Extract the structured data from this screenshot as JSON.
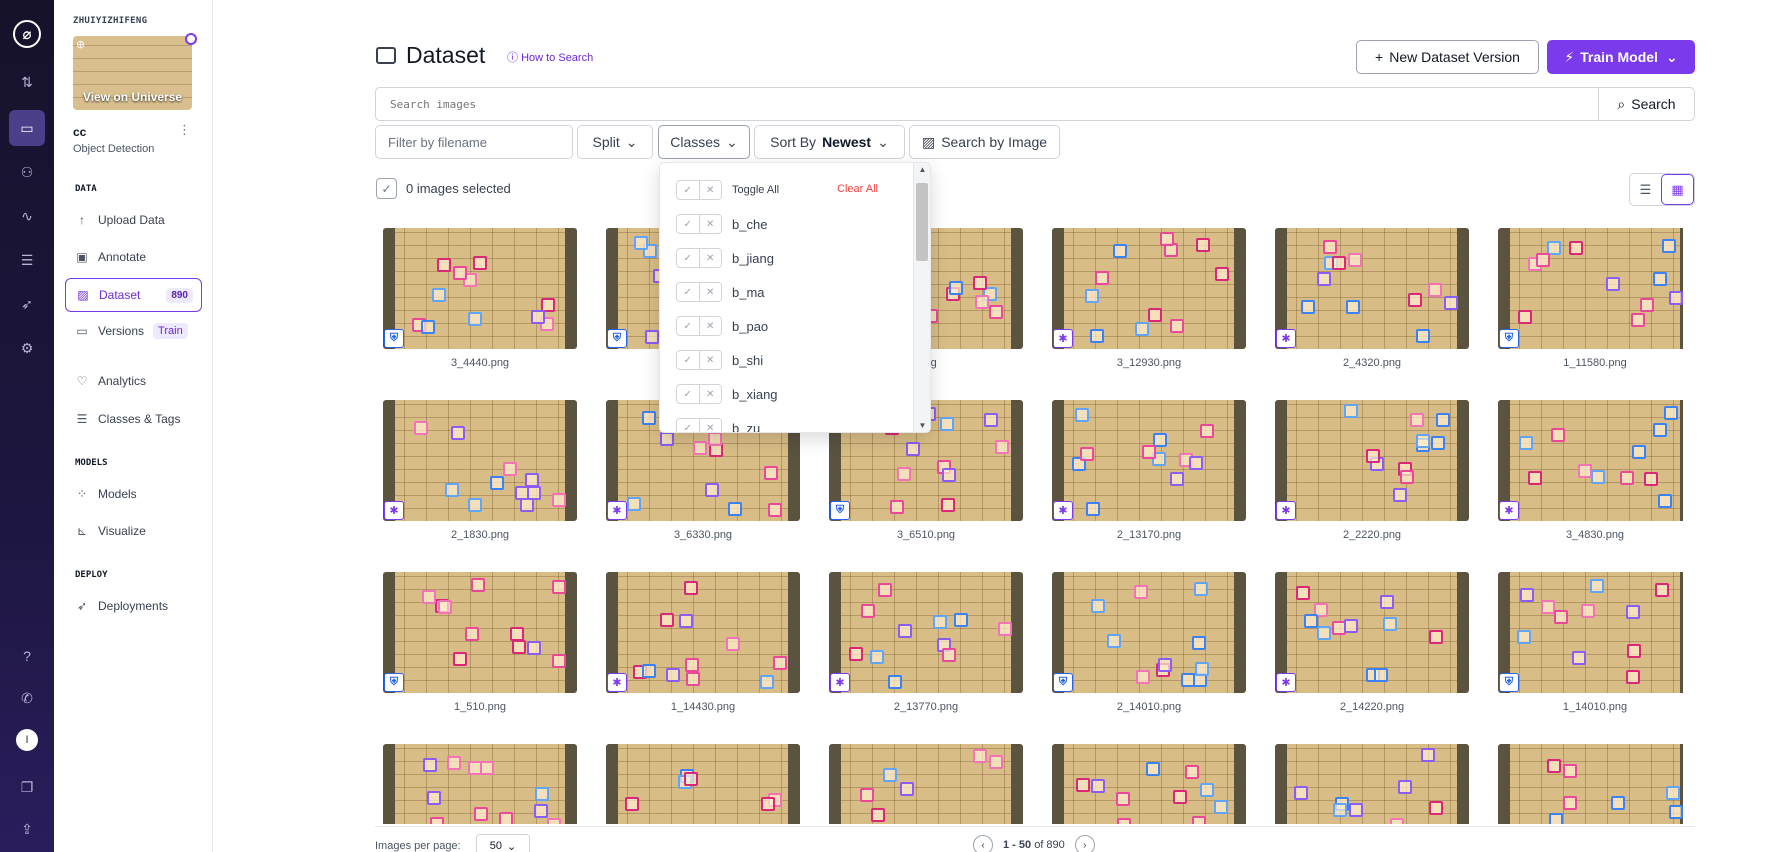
{
  "workspace": {
    "name": "ZHUIYIZHIFENG",
    "view_on_universe": "View on Universe"
  },
  "project": {
    "name": "cc",
    "type": "Object Detection"
  },
  "sidebar": {
    "sections": {
      "data": "DATA",
      "models": "MODELS",
      "deploy": "DEPLOY"
    },
    "items": [
      {
        "label": "Upload Data",
        "icon": "upload-icon"
      },
      {
        "label": "Annotate",
        "icon": "annotate-icon"
      },
      {
        "label": "Dataset",
        "icon": "dataset-icon",
        "badge": "890",
        "active": true
      },
      {
        "label": "Versions",
        "icon": "versions-icon",
        "badge": "Train"
      },
      {
        "label": "Analytics",
        "icon": "analytics-icon"
      },
      {
        "label": "Classes & Tags",
        "icon": "list-icon"
      },
      {
        "label": "Models",
        "icon": "models-icon"
      },
      {
        "label": "Visualize",
        "icon": "chart-icon"
      },
      {
        "label": "Deployments",
        "icon": "rocket-icon"
      }
    ],
    "avatar_letter": "I"
  },
  "header": {
    "title": "Dataset",
    "how_to_search": "How to Search",
    "new_version": "New Dataset Version",
    "train_model": "Train Model"
  },
  "search": {
    "placeholder": "Search images",
    "button": "Search"
  },
  "filters": {
    "filename_placeholder": "Filter by filename",
    "split": "Split",
    "classes": "Classes",
    "sort_label": "Sort By",
    "sort_value": "Newest",
    "search_by_image": "Search by Image"
  },
  "selection": {
    "text": "0 images selected"
  },
  "classes_dropdown": {
    "toggle_all": "Toggle All",
    "clear_all": "Clear All",
    "classes": [
      "b_che",
      "b_jiang",
      "b_ma",
      "b_pao",
      "b_shi",
      "b_xiang",
      "b_zu"
    ]
  },
  "images": [
    {
      "name": "3_4440.png",
      "badge": "shield"
    },
    {
      "name": "",
      "badge": "shield"
    },
    {
      "name": ".png",
      "badge": "shield"
    },
    {
      "name": "3_12930.png",
      "badge": "runner"
    },
    {
      "name": "2_4320.png",
      "badge": "runner"
    },
    {
      "name": "1_11580.png",
      "badge": "shield"
    },
    {
      "name": "2_1830.png",
      "badge": "runner"
    },
    {
      "name": "3_6330.png",
      "badge": "runner"
    },
    {
      "name": "3_6510.png",
      "badge": "shield"
    },
    {
      "name": "2_13170.png",
      "badge": "runner"
    },
    {
      "name": "2_2220.png",
      "badge": "runner"
    },
    {
      "name": "3_4830.png",
      "badge": "runner"
    },
    {
      "name": "1_510.png",
      "badge": "shield"
    },
    {
      "name": "1_14430.png",
      "badge": "runner"
    },
    {
      "name": "2_13770.png",
      "badge": "runner"
    },
    {
      "name": "2_14010.png",
      "badge": "shield"
    },
    {
      "name": "2_14220.png",
      "badge": "runner"
    },
    {
      "name": "1_14010.png",
      "badge": "shield"
    },
    {
      "name": "",
      "badge": ""
    },
    {
      "name": "",
      "badge": ""
    },
    {
      "name": "",
      "badge": ""
    },
    {
      "name": "",
      "badge": ""
    },
    {
      "name": "",
      "badge": ""
    },
    {
      "name": "",
      "badge": ""
    }
  ],
  "footer": {
    "images_per_page_label": "Images per page:",
    "images_per_page": "50",
    "range": "1 - 50",
    "of": "of 890"
  },
  "colors": {
    "accent": "#7c3aed",
    "shield": "#2563eb",
    "danger": "#ef4444"
  }
}
